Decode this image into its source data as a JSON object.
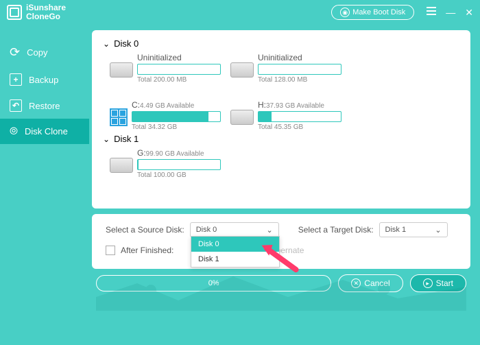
{
  "app": {
    "name": "iSunshare\nCloneGo"
  },
  "titlebar": {
    "makeBootDisk": "Make Boot Disk"
  },
  "sidebar": {
    "items": [
      {
        "label": "Copy"
      },
      {
        "label": "Backup"
      },
      {
        "label": "Restore"
      },
      {
        "label": "Disk Clone"
      }
    ]
  },
  "disks": [
    {
      "name": "Disk 0",
      "partitions": [
        {
          "label": "Uninitialized",
          "avail": "",
          "total": "Total 200.00 MB",
          "fillPct": 0,
          "os": false
        },
        {
          "label": "Uninitialized",
          "avail": "",
          "total": "Total 128.00 MB",
          "fillPct": 0,
          "os": false
        },
        {
          "label": "C:",
          "avail": "4.49 GB Available",
          "total": "Total 34.32 GB",
          "fillPct": 87,
          "os": true
        },
        {
          "label": "H:",
          "avail": "37.93 GB Available",
          "total": "Total 45.35 GB",
          "fillPct": 16,
          "os": false
        }
      ]
    },
    {
      "name": "Disk 1",
      "partitions": [
        {
          "label": "G:",
          "avail": "99.90 GB Available",
          "total": "Total 100.00 GB",
          "fillPct": 1,
          "os": false
        }
      ]
    }
  ],
  "config": {
    "sourceLabel": "Select a Source Disk:",
    "sourceValue": "Disk 0",
    "targetLabel": "Select a Target Disk:",
    "targetValue": "Disk 1",
    "afterFinishedLabel": "After Finished:",
    "afterOption": "Hibernate",
    "dropdown": [
      "Disk 0",
      "Disk 1"
    ]
  },
  "bottom": {
    "progress": "0%",
    "cancel": "Cancel",
    "start": "Start"
  }
}
